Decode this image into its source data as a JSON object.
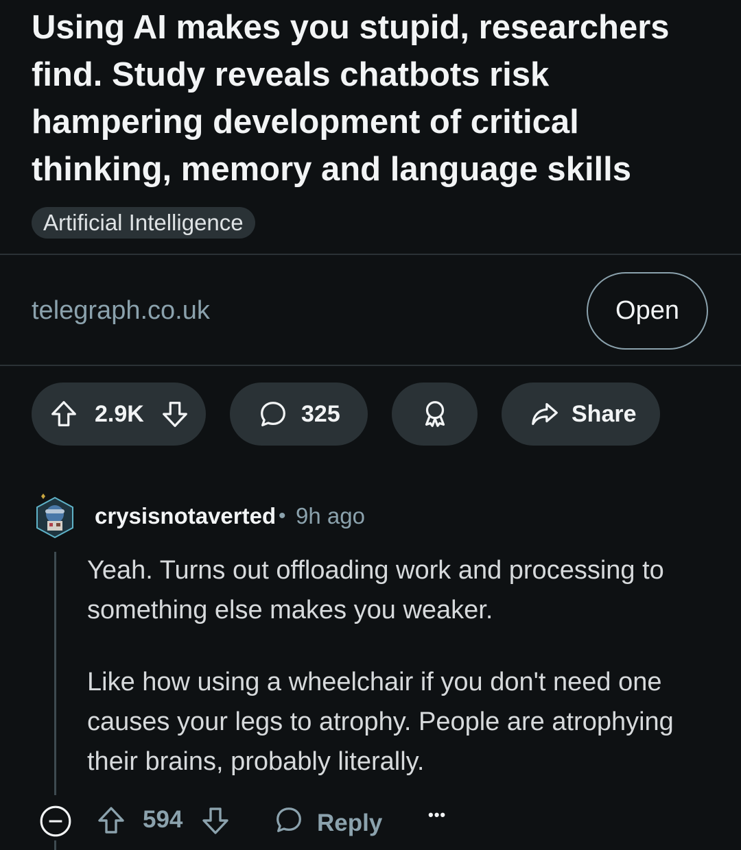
{
  "post": {
    "title": "Using AI makes you stupid, researchers find. Study reveals chatbots risk hampering development of critical thinking, memory and language skills",
    "flair": "Artificial Intelligence",
    "domain": "telegraph.co.uk",
    "open_label": "Open"
  },
  "actions": {
    "votes": "2.9K",
    "comments": "325",
    "share_label": "Share"
  },
  "comment": {
    "author": "crysisnotaverted",
    "separator": "•",
    "time": "9h ago",
    "paragraphs": [
      "Yeah. Turns out offloading work and processing to something else makes you weaker.",
      "Like how using a wheelchair if you don't need one causes your legs to atrophy. People are atrophying their brains, probably literally."
    ],
    "score": "594",
    "reply_label": "Reply",
    "more_label": "•••"
  },
  "icons": {
    "upvote": "arrow-up-icon",
    "downvote": "arrow-down-icon",
    "comments": "speech-bubble-icon",
    "award": "award-ribbon-icon",
    "share": "share-arrow-icon",
    "collapse": "minus-circle-icon"
  },
  "colors": {
    "background": "#0e1113",
    "pill": "#2a3236",
    "muted_text": "#8ba2ad",
    "primary_text": "#f2f4f5"
  }
}
